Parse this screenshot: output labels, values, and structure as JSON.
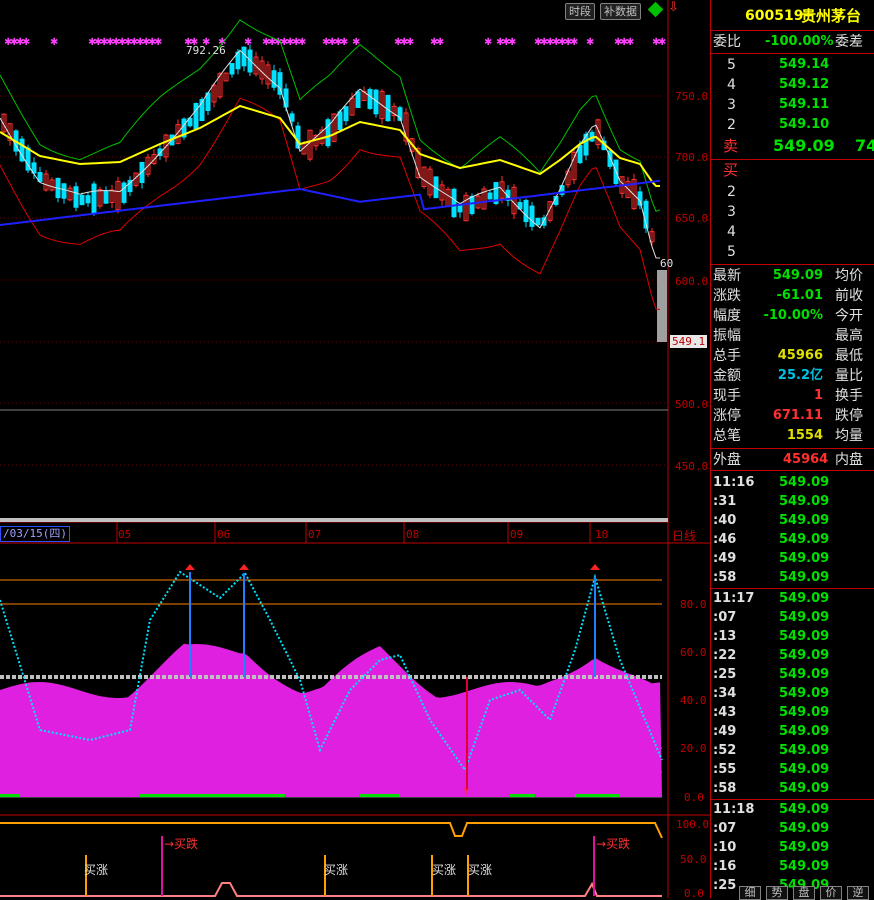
{
  "toolbar": {
    "btn_timeshare": "时段",
    "btn_fill_data": "补数据"
  },
  "stock": {
    "code": "600519",
    "name": "贵州茅台"
  },
  "chart": {
    "high_label": "792.26",
    "current_price_tag": "549.1",
    "partial_tag": "60",
    "price_axis": [
      "750.0",
      "700.0",
      "650.0",
      "600.0",
      "500.0",
      "450.0"
    ],
    "date_label": "/03/15(四)",
    "month_labels": [
      "05",
      "06",
      "07",
      "08",
      "09",
      "10"
    ],
    "period_label": "日线",
    "indicator_axis": [
      "80.0",
      "60.0",
      "40.0",
      "20.0",
      "0.0"
    ],
    "signal_axis": [
      "100.0",
      "50.0",
      "0.0"
    ],
    "buy_marker": "Y",
    "signal_labels": {
      "buy_rise": "买涨",
      "buy_fall": "→买跌"
    }
  },
  "order_book": {
    "wei_bi_label": "委比",
    "wei_bi_value": "-100.00%",
    "wei_cha_label": "委差",
    "sell_label": "卖",
    "buy_label": "买",
    "sells": [
      {
        "level": "5",
        "price": "549.14"
      },
      {
        "level": "4",
        "price": "549.12"
      },
      {
        "level": "3",
        "price": "549.11"
      },
      {
        "level": "2",
        "price": "549.10"
      }
    ],
    "sell1_price": "549.09",
    "sell1_volume": "74",
    "buys": [
      {
        "level": "2"
      },
      {
        "level": "3"
      },
      {
        "level": "4"
      },
      {
        "level": "5"
      }
    ]
  },
  "quote": {
    "rows": [
      {
        "label": "最新",
        "value": "549.09",
        "label2": "均价",
        "color": "#00e000"
      },
      {
        "label": "涨跌",
        "value": "-61.01",
        "label2": "前收",
        "color": "#00e000"
      },
      {
        "label": "幅度",
        "value": "-10.00%",
        "label2": "今开",
        "color": "#00e000"
      },
      {
        "label": "振幅",
        "value": "",
        "label2": "最高",
        "color": "#00e000"
      },
      {
        "label": "总手",
        "value": "45966",
        "label2": "最低",
        "color": "#e0e000"
      },
      {
        "label": "金额",
        "value": "25.2亿",
        "label2": "量比",
        "color": "#00c0e0"
      },
      {
        "label": "现手",
        "value": "1",
        "label2": "换手",
        "color": "#ff3030"
      },
      {
        "label": "涨停",
        "value": "671.11",
        "label2": "跌停",
        "color": "#ff3030"
      },
      {
        "label": "总笔",
        "value": "1554",
        "label2": "均量",
        "color": "#e0e000"
      }
    ],
    "outer_label": "外盘",
    "outer_value": "45964",
    "inner_label": "内盘"
  },
  "ticks": [
    {
      "time": "11:16",
      "price": "549.09"
    },
    {
      "time": ":31",
      "price": "549.09"
    },
    {
      "time": ":40",
      "price": "549.09"
    },
    {
      "time": ":46",
      "price": "549.09"
    },
    {
      "time": ":49",
      "price": "549.09"
    },
    {
      "time": ":58",
      "price": "549.09"
    },
    {
      "time": "11:17",
      "price": "549.09"
    },
    {
      "time": ":07",
      "price": "549.09"
    },
    {
      "time": ":13",
      "price": "549.09"
    },
    {
      "time": ":22",
      "price": "549.09"
    },
    {
      "time": ":25",
      "price": "549.09"
    },
    {
      "time": ":34",
      "price": "549.09"
    },
    {
      "time": ":43",
      "price": "549.09"
    },
    {
      "time": ":49",
      "price": "549.09"
    },
    {
      "time": ":52",
      "price": "549.09"
    },
    {
      "time": ":55",
      "price": "549.09"
    },
    {
      "time": ":58",
      "price": "549.09"
    },
    {
      "time": "11:18",
      "price": "549.09"
    },
    {
      "time": ":07",
      "price": "549.09"
    },
    {
      "time": ":10",
      "price": "549.09"
    },
    {
      "time": ":16",
      "price": "549.09"
    },
    {
      "time": ":25",
      "price": "549.09"
    }
  ],
  "bottom_tabs": [
    "细",
    "势",
    "盘",
    "价",
    "逆"
  ]
}
